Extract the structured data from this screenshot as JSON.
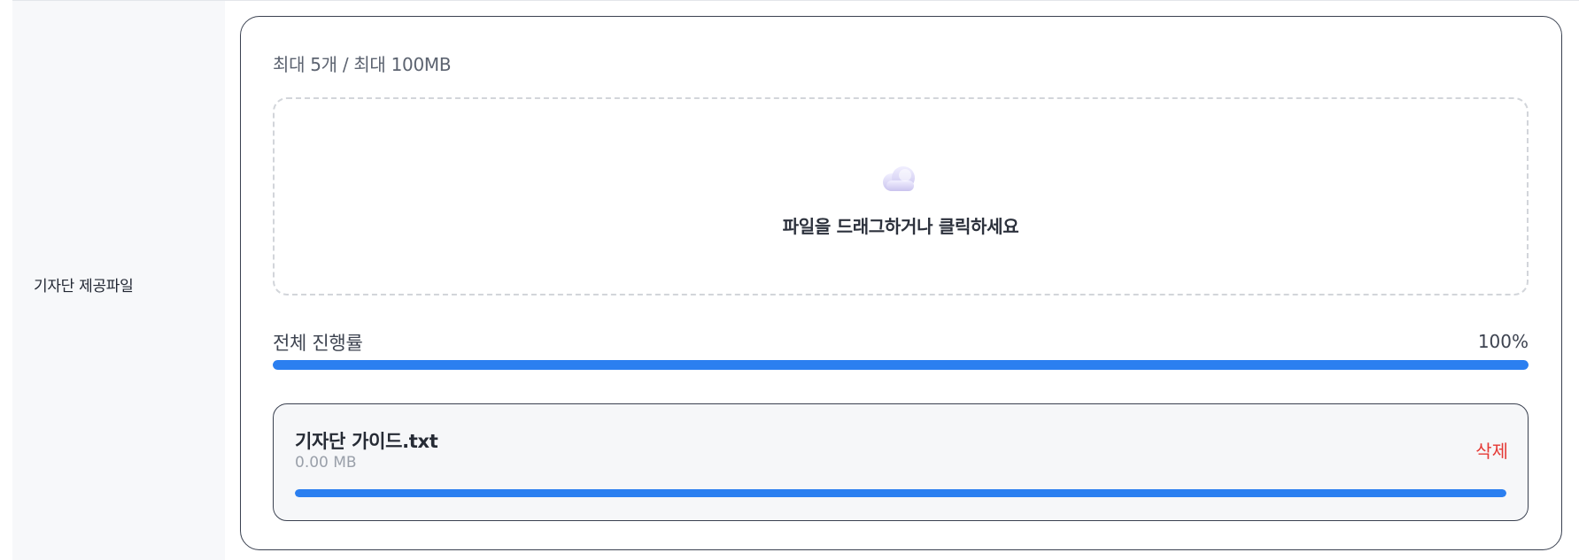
{
  "field": {
    "label": "기자단 제공파일"
  },
  "upload": {
    "limit_text": "최대 5개 / 최대 100MB",
    "dropzone": {
      "icon": "cloud-upload-icon",
      "text": "파일을 드래그하거나 클릭하세요"
    },
    "total_progress": {
      "label": "전체 진행률",
      "percent_text": "100%",
      "value": 1.0
    },
    "files": [
      {
        "name": "기자단 가이드.txt",
        "size": "0.00 MB",
        "delete_label": "삭제",
        "progress": 1.0
      }
    ]
  },
  "colors": {
    "accent": "#2b7ff0",
    "danger": "#e53935",
    "border": "#3a4150"
  }
}
